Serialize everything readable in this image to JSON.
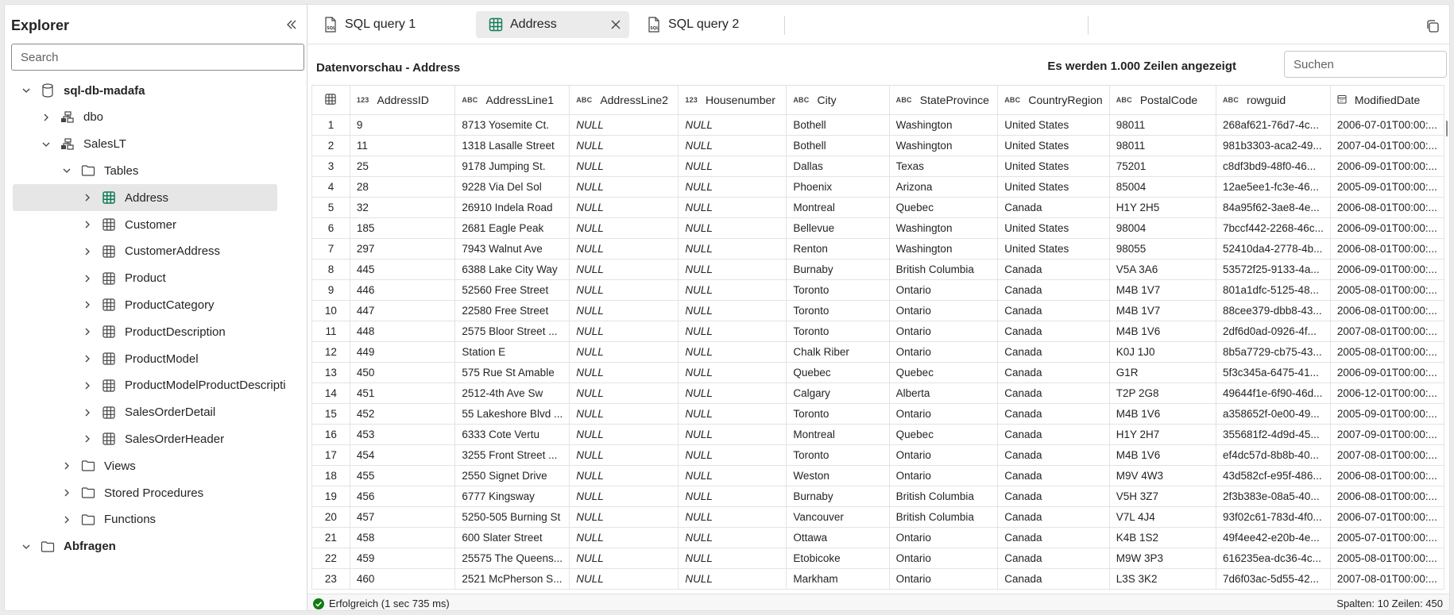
{
  "explorer": {
    "title": "Explorer",
    "search_placeholder": "Search",
    "tree": [
      {
        "label": "sql-db-madafa",
        "level": 0,
        "icon": "database-icon",
        "expanded": true,
        "bold": true
      },
      {
        "label": "dbo",
        "level": 1,
        "icon": "schema-icon",
        "expanded": false
      },
      {
        "label": "SalesLT",
        "level": 1,
        "icon": "schema-icon",
        "expanded": true
      },
      {
        "label": "Tables",
        "level": 2,
        "icon": "folder-icon",
        "expanded": true
      },
      {
        "label": "Address",
        "level": 3,
        "icon": "table-icon",
        "expanded": false,
        "selected": true
      },
      {
        "label": "Customer",
        "level": 3,
        "icon": "table-icon",
        "expanded": false
      },
      {
        "label": "CustomerAddress",
        "level": 3,
        "icon": "table-icon",
        "expanded": false
      },
      {
        "label": "Product",
        "level": 3,
        "icon": "table-icon",
        "expanded": false
      },
      {
        "label": "ProductCategory",
        "level": 3,
        "icon": "table-icon",
        "expanded": false
      },
      {
        "label": "ProductDescription",
        "level": 3,
        "icon": "table-icon",
        "expanded": false
      },
      {
        "label": "ProductModel",
        "level": 3,
        "icon": "table-icon",
        "expanded": false
      },
      {
        "label": "ProductModelProductDescripti",
        "level": 3,
        "icon": "table-icon",
        "expanded": false
      },
      {
        "label": "SalesOrderDetail",
        "level": 3,
        "icon": "table-icon",
        "expanded": false
      },
      {
        "label": "SalesOrderHeader",
        "level": 3,
        "icon": "table-icon",
        "expanded": false
      },
      {
        "label": "Views",
        "level": 2,
        "icon": "folder-icon",
        "expanded": false
      },
      {
        "label": "Stored Procedures",
        "level": 2,
        "icon": "folder-icon",
        "expanded": false
      },
      {
        "label": "Functions",
        "level": 2,
        "icon": "folder-icon",
        "expanded": false
      },
      {
        "label": "Abfragen",
        "level": 0,
        "icon": "folder-icon",
        "expanded": true,
        "bold": true
      }
    ]
  },
  "tabs": [
    {
      "label": "SQL query 1",
      "icon": "sql-file-icon",
      "active": false
    },
    {
      "label": "Address",
      "icon": "table-icon",
      "active": true
    },
    {
      "label": "SQL query 2",
      "icon": "sql-file-icon",
      "active": false
    }
  ],
  "preview": {
    "title": "Datenvorschau - Address",
    "row_count_text": "Es werden 1.000 Zeilen angezeigt",
    "search_placeholder": "Suchen"
  },
  "grid": {
    "columns": [
      {
        "name": "AddressID",
        "type": "123"
      },
      {
        "name": "AddressLine1",
        "type": "ABC"
      },
      {
        "name": "AddressLine2",
        "type": "ABC"
      },
      {
        "name": "Housenumber",
        "type": "123"
      },
      {
        "name": "City",
        "type": "ABC"
      },
      {
        "name": "StateProvince",
        "type": "ABC"
      },
      {
        "name": "CountryRegion",
        "type": "ABC"
      },
      {
        "name": "PostalCode",
        "type": "ABC"
      },
      {
        "name": "rowguid",
        "type": "ABC"
      },
      {
        "name": "ModifiedDate",
        "type": "calendar-icon"
      }
    ],
    "rows": [
      [
        "1",
        "9",
        "8713 Yosemite Ct.",
        "NULL",
        "NULL",
        "Bothell",
        "Washington",
        "United States",
        "98011",
        "268af621-76d7-4c...",
        "2006-07-01T00:00:..."
      ],
      [
        "2",
        "11",
        "1318 Lasalle Street",
        "NULL",
        "NULL",
        "Bothell",
        "Washington",
        "United States",
        "98011",
        "981b3303-aca2-49...",
        "2007-04-01T00:00:..."
      ],
      [
        "3",
        "25",
        "9178 Jumping St.",
        "NULL",
        "NULL",
        "Dallas",
        "Texas",
        "United States",
        "75201",
        "c8df3bd9-48f0-46...",
        "2006-09-01T00:00:..."
      ],
      [
        "4",
        "28",
        "9228 Via Del Sol",
        "NULL",
        "NULL",
        "Phoenix",
        "Arizona",
        "United States",
        "85004",
        "12ae5ee1-fc3e-46...",
        "2005-09-01T00:00:..."
      ],
      [
        "5",
        "32",
        "26910 Indela Road",
        "NULL",
        "NULL",
        "Montreal",
        "Quebec",
        "Canada",
        "H1Y 2H5",
        "84a95f62-3ae8-4e...",
        "2006-08-01T00:00:..."
      ],
      [
        "6",
        "185",
        "2681 Eagle Peak",
        "NULL",
        "NULL",
        "Bellevue",
        "Washington",
        "United States",
        "98004",
        "7bccf442-2268-46c...",
        "2006-09-01T00:00:..."
      ],
      [
        "7",
        "297",
        "7943 Walnut Ave",
        "NULL",
        "NULL",
        "Renton",
        "Washington",
        "United States",
        "98055",
        "52410da4-2778-4b...",
        "2006-08-01T00:00:..."
      ],
      [
        "8",
        "445",
        "6388 Lake City Way",
        "NULL",
        "NULL",
        "Burnaby",
        "British Columbia",
        "Canada",
        "V5A 3A6",
        "53572f25-9133-4a...",
        "2006-09-01T00:00:..."
      ],
      [
        "9",
        "446",
        "52560 Free Street",
        "NULL",
        "NULL",
        "Toronto",
        "Ontario",
        "Canada",
        "M4B 1V7",
        "801a1dfc-5125-48...",
        "2005-08-01T00:00:..."
      ],
      [
        "10",
        "447",
        "22580 Free Street",
        "NULL",
        "NULL",
        "Toronto",
        "Ontario",
        "Canada",
        "M4B 1V7",
        "88cee379-dbb8-43...",
        "2006-08-01T00:00:..."
      ],
      [
        "11",
        "448",
        "2575 Bloor Street ...",
        "NULL",
        "NULL",
        "Toronto",
        "Ontario",
        "Canada",
        "M4B 1V6",
        "2df6d0ad-0926-4f...",
        "2007-08-01T00:00:..."
      ],
      [
        "12",
        "449",
        "Station E",
        "NULL",
        "NULL",
        "Chalk Riber",
        "Ontario",
        "Canada",
        "K0J 1J0",
        "8b5a7729-cb75-43...",
        "2005-08-01T00:00:..."
      ],
      [
        "13",
        "450",
        "575 Rue St Amable",
        "NULL",
        "NULL",
        "Quebec",
        "Quebec",
        "Canada",
        "G1R",
        "5f3c345a-6475-41...",
        "2006-09-01T00:00:..."
      ],
      [
        "14",
        "451",
        "2512-4th Ave Sw",
        "NULL",
        "NULL",
        "Calgary",
        "Alberta",
        "Canada",
        "T2P 2G8",
        "49644f1e-6f90-46d...",
        "2006-12-01T00:00:..."
      ],
      [
        "15",
        "452",
        "55 Lakeshore Blvd ...",
        "NULL",
        "NULL",
        "Toronto",
        "Ontario",
        "Canada",
        "M4B 1V6",
        "a358652f-0e00-49...",
        "2005-09-01T00:00:..."
      ],
      [
        "16",
        "453",
        "6333 Cote Vertu",
        "NULL",
        "NULL",
        "Montreal",
        "Quebec",
        "Canada",
        "H1Y 2H7",
        "355681f2-4d9d-45...",
        "2007-09-01T00:00:..."
      ],
      [
        "17",
        "454",
        "3255 Front Street ...",
        "NULL",
        "NULL",
        "Toronto",
        "Ontario",
        "Canada",
        "M4B 1V6",
        "ef4dc57d-8b8b-40...",
        "2007-08-01T00:00:..."
      ],
      [
        "18",
        "455",
        "2550 Signet Drive",
        "NULL",
        "NULL",
        "Weston",
        "Ontario",
        "Canada",
        "M9V 4W3",
        "43d582cf-e95f-486...",
        "2006-08-01T00:00:..."
      ],
      [
        "19",
        "456",
        "6777 Kingsway",
        "NULL",
        "NULL",
        "Burnaby",
        "British Columbia",
        "Canada",
        "V5H 3Z7",
        "2f3b383e-08a5-40...",
        "2006-08-01T00:00:..."
      ],
      [
        "20",
        "457",
        "5250-505 Burning St",
        "NULL",
        "NULL",
        "Vancouver",
        "British Columbia",
        "Canada",
        "V7L 4J4",
        "93f02c61-783d-4f0...",
        "2006-07-01T00:00:..."
      ],
      [
        "21",
        "458",
        "600 Slater Street",
        "NULL",
        "NULL",
        "Ottawa",
        "Ontario",
        "Canada",
        "K4B 1S2",
        "49f4ee42-e20b-4e...",
        "2005-07-01T00:00:..."
      ],
      [
        "22",
        "459",
        "25575 The Queens...",
        "NULL",
        "NULL",
        "Etobicoke",
        "Ontario",
        "Canada",
        "M9W 3P3",
        "616235ea-dc36-4c...",
        "2005-08-01T00:00:..."
      ],
      [
        "23",
        "460",
        "2521 McPherson S...",
        "NULL",
        "NULL",
        "Markham",
        "Ontario",
        "Canada",
        "L3S 3K2",
        "7d6f03ac-5d55-42...",
        "2007-08-01T00:00:..."
      ]
    ]
  },
  "status": {
    "left": "Erfolgreich (1 sec 735 ms)",
    "right": "Spalten: 10 Zeilen: 450"
  },
  "colors": {
    "success": "#107c10",
    "table_icon_active": "#0f7b54",
    "selected_bg": "#e6e6e6"
  }
}
